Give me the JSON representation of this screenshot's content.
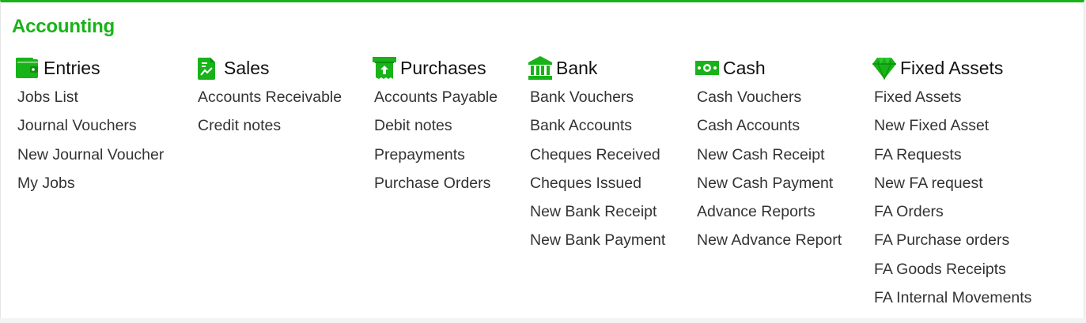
{
  "section_title": "Accounting",
  "accent_color": "#18b318",
  "columns": [
    {
      "icon": "wallet-icon",
      "heading": "Entries",
      "links": [
        "Jobs List",
        "Journal Vouchers",
        "New Journal Voucher",
        "My Jobs"
      ]
    },
    {
      "icon": "chart-document-icon",
      "heading": "Sales",
      "links": [
        "Accounts Receivable",
        "Credit notes"
      ]
    },
    {
      "icon": "receipt-icon",
      "heading": "Purchases",
      "links": [
        "Accounts Payable",
        "Debit notes",
        "Prepayments",
        "Purchase Orders"
      ]
    },
    {
      "icon": "bank-icon",
      "heading": "Bank",
      "links": [
        "Bank Vouchers",
        "Bank Accounts",
        "Cheques Received",
        "Cheques Issued",
        "New Bank Receipt",
        "New Bank Payment"
      ]
    },
    {
      "icon": "cash-icon",
      "heading": "Cash",
      "links": [
        "Cash Vouchers",
        "Cash Accounts",
        "New Cash Receipt",
        "New Cash Payment",
        "Advance Reports",
        "New Advance Report"
      ]
    },
    {
      "icon": "diamond-icon",
      "heading": "Fixed Assets",
      "links": [
        "Fixed Assets",
        "New Fixed Asset",
        "FA Requests",
        "New FA request",
        "FA Orders",
        "FA Purchase orders",
        "FA Goods Receipts",
        "FA Internal Movements"
      ]
    }
  ]
}
